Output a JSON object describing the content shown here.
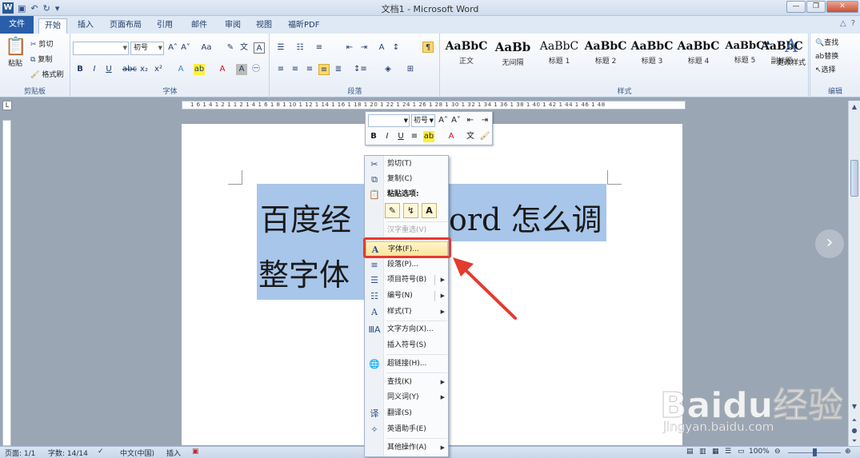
{
  "window": {
    "title": "文档1 - Microsoft Word",
    "app_icon": "W"
  },
  "tabs": {
    "file": "文件",
    "items": [
      "开始",
      "插入",
      "页面布局",
      "引用",
      "邮件",
      "审阅",
      "视图",
      "福昕PDF"
    ],
    "active": "开始"
  },
  "ribbon": {
    "clipboard": {
      "label": "剪贴板",
      "paste": "粘贴",
      "cut": "剪切",
      "copy": "复制",
      "format_painter": "格式刷"
    },
    "font": {
      "label": "字体",
      "font_name": "",
      "font_size": "初号",
      "aa": "Aa"
    },
    "paragraph": {
      "label": "段落"
    },
    "styles": {
      "label": "样式",
      "items": [
        {
          "sample": "AaBbC",
          "name": "正文"
        },
        {
          "sample": "AaBb",
          "name": "无间隔"
        },
        {
          "sample": "AaBbC",
          "name": "标题 1"
        },
        {
          "sample": "AaBbC",
          "name": "标题 2"
        },
        {
          "sample": "AaBbC",
          "name": "标题 3"
        },
        {
          "sample": "AaBbC",
          "name": "标题 4"
        },
        {
          "sample": "AaBbC",
          "name": "标题 5"
        },
        {
          "sample": "AaBbC",
          "name": "副标题"
        }
      ],
      "change_styles": "更改样式"
    },
    "editing": {
      "label": "编辑",
      "find": "查找",
      "replace": "替换",
      "select": "选择"
    }
  },
  "ruler": {
    "ticks": "1 6 1 4 1 2 1   1 2 1 4 1 6 1 8 1 10 1 12 1 14 1 16 1 18 1 20 1 22 1 24 1 26 1 28 1 30 1 32 1 34 1 36 1 38 1 40 1 42 1 44 1 46 1 48"
  },
  "document": {
    "line1_left": "百度经",
    "line1_right": "ord 怎么调",
    "line2": "整字体"
  },
  "mini_toolbar": {
    "font_name": "",
    "font_size": "初号"
  },
  "context_menu": {
    "cut": "剪切(T)",
    "copy": "复制(C)",
    "paste_options": "粘贴选项:",
    "reconvert": "汉字重选(V)",
    "font": "字体(F)...",
    "paragraph": "段落(P)...",
    "bullets": "项目符号(B)",
    "numbering": "编号(N)",
    "styles": "样式(T)",
    "text_direction": "文字方向(X)...",
    "insert_symbol": "插入符号(S)",
    "hyperlink": "超链接(H)...",
    "lookup": "查找(K)",
    "synonyms": "同义词(Y)",
    "translate": "翻译(S)",
    "english_assistant": "英语助手(E)",
    "other_actions": "其他操作(A)"
  },
  "statusbar": {
    "page": "页面: 1/1",
    "words": "字数: 14/14",
    "language": "中文(中国)",
    "mode": "插入",
    "zoom": "100%"
  },
  "watermark": {
    "logo": "Baidu经验",
    "url": "jingyan.baidu.com"
  },
  "colors": {
    "file_tab": "#2a5ea8",
    "selection": "#a8c6ea",
    "annotation_red": "#e53a2e",
    "menu_highlight": "#fbe39a"
  }
}
